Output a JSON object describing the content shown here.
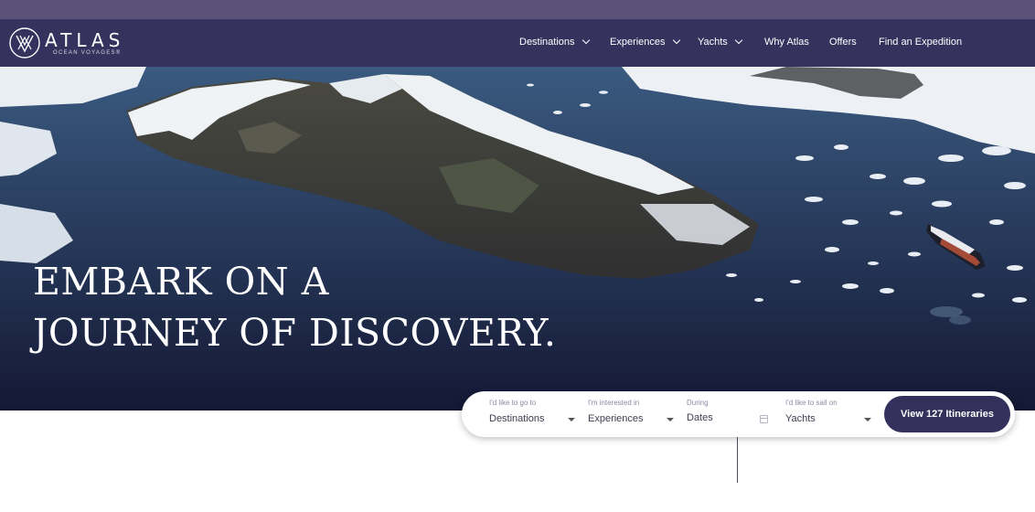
{
  "brand": {
    "name": "ATLAS",
    "tagline": "OCEAN VOYAGES®"
  },
  "nav": {
    "items": [
      {
        "label": "Destinations",
        "dropdown": true
      },
      {
        "label": "Experiences",
        "dropdown": true
      },
      {
        "label": "Yachts",
        "dropdown": true
      },
      {
        "label": "Why Atlas",
        "dropdown": false
      },
      {
        "label": "Offers",
        "dropdown": false
      },
      {
        "label": "Find an Expedition",
        "dropdown": false
      }
    ]
  },
  "hero": {
    "headline_line1": "EMBARK ON A",
    "headline_line2": "JOURNEY OF DISCOVERY."
  },
  "search": {
    "destination": {
      "label": "I'd like to go to",
      "value": "Destinations"
    },
    "experience": {
      "label": "I'm interested in",
      "value": "Experiences"
    },
    "dates": {
      "label": "During",
      "value": "Dates"
    },
    "yacht": {
      "label": "I'd like to sail on",
      "value": "Yachts"
    },
    "cta_label": "View 127 Itineraries"
  },
  "colors": {
    "nav_bg": "#35325e",
    "top_strip": "#5a5278",
    "cta_bg": "#33305c"
  }
}
